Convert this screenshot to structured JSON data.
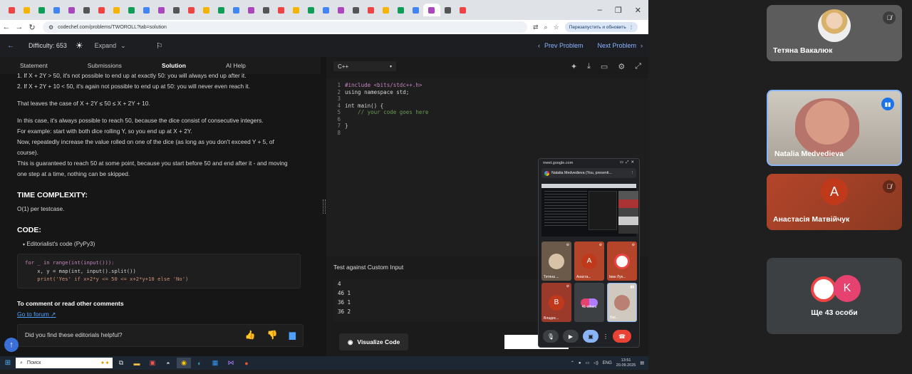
{
  "browser": {
    "tab_count": 31,
    "url": "codechef.com/problems/TWOROLL?tab=solution",
    "restart_label": "Перезапустить и обновить"
  },
  "header": {
    "difficulty": "Difficulty: 653",
    "expand": "Expand",
    "prev": "Prev Problem",
    "next": "Next Problem"
  },
  "left": {
    "tabs": [
      "Statement",
      "Submissions",
      "Solution",
      "AI Help"
    ],
    "lines": {
      "l1": "1. If X + 2Y > 50, it's not possible to end up at exactly 50: you will always end up after it.",
      "l2": "2. If X + 2Y + 10 < 50, it's again not possible to end up at 50: you will never even reach it.",
      "l3": "That leaves the case of X + 2Y ≤ 50 ≤ X + 2Y + 10.",
      "l4": "In this case, it's always possible to reach 50, because the dice consist of consecutive integers.",
      "l5": "For example: start with both dice rolling Y, so you end up at X + 2Y.",
      "l6": "Now, repeatedly increase the value rolled on one of the dice (as long as you don't exceed Y + 5, of",
      "l7": "course).",
      "l8": "This is guaranteed to reach 50 at some point, because you start before 50 and end after it - and moving",
      "l9": "one step at a time, nothing can be skipped."
    },
    "time_heading": "TIME COMPLEXITY:",
    "time_value": "O(1) per testcase.",
    "code_heading": "CODE:",
    "code_toggle": "Editorialist's code (PyPy3)",
    "code": {
      "c1": "for _ in range(int(input())):",
      "c2": "    x, y = map(int, input().split())",
      "c3": "    print('Yes' if x+2*y <= 50 <= x+2*y+10 else 'No')"
    },
    "comment_heading": "To comment or read other comments",
    "forum_link": "Go to forum ↗",
    "feedback": "Did you find these editorials helpful?"
  },
  "editor": {
    "language": "C++",
    "line_numbers": [
      "1",
      "2",
      "3",
      "4",
      "5",
      "6",
      "7",
      "8"
    ],
    "lines": {
      "a1": "#include <bits/stdc++.h>",
      "a2": "using namespace std;",
      "a3": "",
      "a4": "int main() {",
      "a5": "    // your code goes here",
      "a6": "",
      "a7": "}",
      "a8": ""
    },
    "custom_label": "Test against Custom Input",
    "custom_input": {
      "r1": "4",
      "r2": "46 1",
      "r3": "36 1",
      "r4": "36 2"
    },
    "visualize": "Visualize Code"
  },
  "pip": {
    "url": "meet.google.com",
    "presenting": "Natalia Medvedieva (You, presenti...",
    "tiles": [
      {
        "name": "Тетяна ...",
        "initial": "",
        "color": "#6b5a4a"
      },
      {
        "name": "Анаста...",
        "initial": "A",
        "color": "#b4452a"
      },
      {
        "name": "Іван Лук...",
        "initial": "",
        "color": "#b4452a"
      },
      {
        "name": "Владис...",
        "initial": "B",
        "color": "#9b3a2a"
      },
      {
        "name": "41 others",
        "initial": "",
        "color": "#3c4043"
      },
      {
        "name": "Nat...",
        "initial": "",
        "color": "#cfc9bf"
      }
    ]
  },
  "taskbar": {
    "search": "Поиск",
    "lang": "ENG",
    "time": "13:51",
    "date": "20.09.2025"
  },
  "meet": {
    "participants": [
      {
        "name": "Тетяна Вакалюк"
      },
      {
        "name": "Natalia Medvedieva"
      },
      {
        "name": "Анастасія Матвійчук",
        "initial": "A"
      },
      {
        "name": "Ще 43 особи",
        "initial": "K"
      }
    ]
  },
  "colors": {
    "accent_blue": "#8ab4f8",
    "link_blue": "#4ea1ff",
    "end_call_red": "#ea4335",
    "avatar_orange": "#c0391b"
  }
}
